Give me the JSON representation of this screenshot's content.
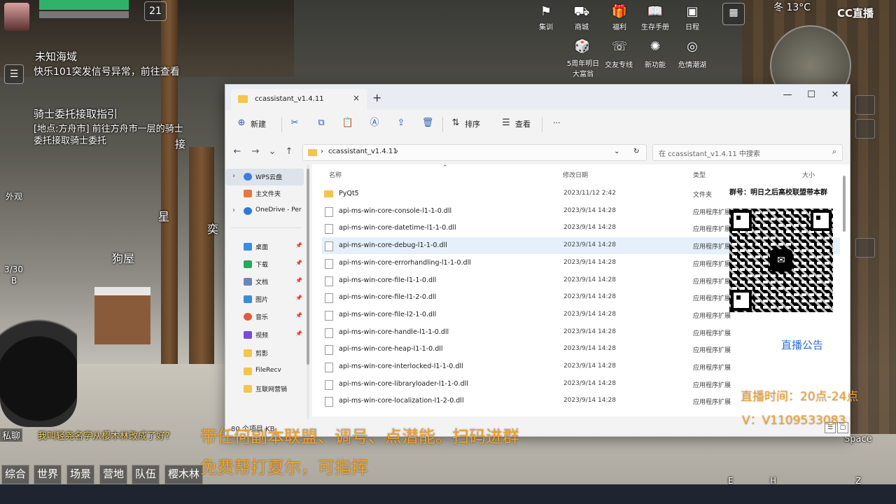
{
  "game_hud": {
    "time": "21",
    "weather": "冬 13°C",
    "top_icons": [
      "集训",
      "商城",
      "福利",
      "生存手册",
      "日程",
      "5周年明日大富翁",
      "交友专线",
      "新功能",
      "危情潮湖"
    ],
    "quest1_title": "未知海域",
    "quest1_desc": "快乐101突发信号异常，前往查看",
    "quest2_title": "骑士委托接取指引",
    "quest2_desc": "[地点:方舟市] 前往方舟市一层的骑士委托接取骑士委托",
    "quest2_action": "接",
    "map_labels": [
      "外观",
      "星",
      "奕",
      "狗屋"
    ],
    "ammo": "3/30",
    "ammo_mode": "B",
    "chat_tabs": [
      "综合",
      "世界",
      "场景",
      "营地",
      "队伍",
      "樱木林"
    ],
    "chat_private": "私聊",
    "chat_msg": "我叫轻尧名字从樱木林改成了好?",
    "space_key": "Space",
    "key_e": "E",
    "key_h": "H",
    "key_z": "Z",
    "cc_logo": "CC直播"
  },
  "explorer": {
    "tab_title": "ccassistant_v1.4.11",
    "new_tab": "+",
    "tab_close": "×",
    "win_min": "—",
    "win_max": "☐",
    "win_close": "✕",
    "toolbar": {
      "new_label": "新建",
      "sort_label": "排序",
      "view_label": "查看",
      "more_label": "···"
    },
    "address": {
      "crumb_sep": "›",
      "crumb": "ccassistant_v1.4.11",
      "search_placeholder": "在 ccassistant_v1.4.11 中搜索"
    },
    "nav": [
      {
        "label": "WPS云盘",
        "icon_color": "#3d7be0",
        "chevron": "›",
        "pin": ""
      },
      {
        "label": "主文件夹",
        "icon_color": "#e07a3d",
        "chevron": "",
        "pin": ""
      },
      {
        "label": "OneDrive - Per",
        "icon_color": "#2f79d6",
        "chevron": "›",
        "pin": ""
      },
      {
        "label": "桌面",
        "icon_color": "#3a8de0",
        "chevron": "",
        "pin": "📌"
      },
      {
        "label": "下载",
        "icon_color": "#2aa65e",
        "chevron": "",
        "pin": "📌"
      },
      {
        "label": "文档",
        "icon_color": "#6a86b8",
        "chevron": "",
        "pin": "📌"
      },
      {
        "label": "图片",
        "icon_color": "#3d8ad6",
        "chevron": "",
        "pin": "📌"
      },
      {
        "label": "音乐",
        "icon_color": "#e05a3d",
        "chevron": "",
        "pin": "📌"
      },
      {
        "label": "视频",
        "icon_color": "#7a4dd6",
        "chevron": "",
        "pin": "📌"
      },
      {
        "label": "剪影",
        "icon_color": "#f4c54c",
        "chevron": "",
        "pin": ""
      },
      {
        "label": "FileRecv",
        "icon_color": "#f4c54c",
        "chevron": "",
        "pin": ""
      },
      {
        "label": "互联网营销",
        "icon_color": "#f4c54c",
        "chevron": "",
        "pin": ""
      }
    ],
    "columns": {
      "name": "名称",
      "date": "修改日期",
      "type": "类型",
      "size": "大小"
    },
    "files": [
      {
        "name": "PyQt5",
        "date": "2023/11/12 2:42",
        "type": "文件夹",
        "kind": "folder"
      },
      {
        "name": "api-ms-win-core-console-l1-1-0.dll",
        "date": "2023/9/14 14:28",
        "type": "应用程序扩展",
        "kind": "file"
      },
      {
        "name": "api-ms-win-core-datetime-l1-1-0.dll",
        "date": "2023/9/14 14:28",
        "type": "应用程序扩展",
        "kind": "file"
      },
      {
        "name": "api-ms-win-core-debug-l1-1-0.dll",
        "date": "2023/9/14 14:28",
        "type": "应用程序扩展",
        "kind": "file"
      },
      {
        "name": "api-ms-win-core-errorhandling-l1-1-0.dll",
        "date": "2023/9/14 14:28",
        "type": "应用程序扩展",
        "kind": "file"
      },
      {
        "name": "api-ms-win-core-file-l1-1-0.dll",
        "date": "2023/9/14 14:28",
        "type": "应用程序扩展",
        "kind": "file"
      },
      {
        "name": "api-ms-win-core-file-l1-2-0.dll",
        "date": "2023/9/14 14:28",
        "type": "应用程序扩展",
        "kind": "file"
      },
      {
        "name": "api-ms-win-core-file-l2-1-0.dll",
        "date": "2023/9/14 14:28",
        "type": "应用程序扩展",
        "kind": "file"
      },
      {
        "name": "api-ms-win-core-handle-l1-1-0.dll",
        "date": "2023/9/14 14:28",
        "type": "应用程序扩展",
        "kind": "file"
      },
      {
        "name": "api-ms-win-core-heap-l1-1-0.dll",
        "date": "2023/9/14 14:28",
        "type": "应用程序扩展",
        "kind": "file"
      },
      {
        "name": "api-ms-win-core-interlocked-l1-1-0.dll",
        "date": "2023/9/14 14:28",
        "type": "应用程序扩展",
        "kind": "file"
      },
      {
        "name": "api-ms-win-core-libraryloader-l1-1-0.dll",
        "date": "2023/9/14 14:28",
        "type": "应用程序扩展",
        "kind": "file"
      },
      {
        "name": "api-ms-win-core-localization-l1-2-0.dll",
        "date": "2023/9/14 14:28",
        "type": "应用程序扩展",
        "kind": "file"
      }
    ],
    "status_text": "80 个项目  KB"
  },
  "overlay": {
    "qr_title": "群号：明日之后高校联盟带本群",
    "notice": "直播公告",
    "stream_time": "直播时间：20点-24点",
    "contact": "V：V1109533083",
    "promo1": "带任何副本联盟、调号、点潜能。扫码进群",
    "promo2": "免费帮打夏尔，可指挥"
  },
  "colors": {
    "accent": "#2f6fd1",
    "promo_orange": "#f0a22b",
    "folder_yellow": "#f4c54c",
    "hover_row": "#e5f0fb"
  }
}
